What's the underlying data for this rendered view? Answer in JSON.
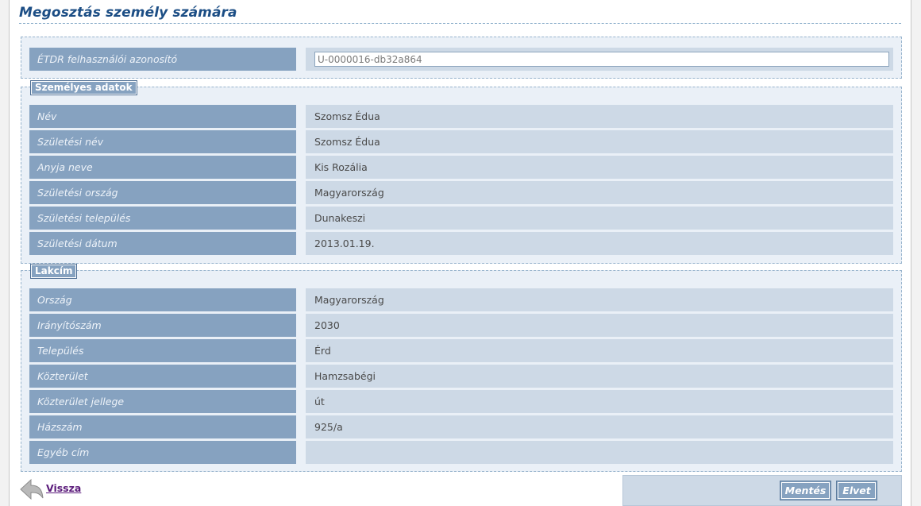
{
  "page_title": "Megosztás személy számára",
  "identifier": {
    "label": "ÉTDR felhasználói azonosító",
    "value": "U-0000016-db32a864"
  },
  "personal": {
    "legend": "Személyes adatok",
    "rows": [
      {
        "label": "Név",
        "value": "Szomsz Édua"
      },
      {
        "label": "Születési név",
        "value": "Szomsz Édua"
      },
      {
        "label": "Anyja neve",
        "value": "Kis Rozália"
      },
      {
        "label": "Születési ország",
        "value": "Magyarország"
      },
      {
        "label": "Születési település",
        "value": "Dunakeszi"
      },
      {
        "label": "Születési dátum",
        "value": "2013.01.19."
      }
    ]
  },
  "address": {
    "legend": "Lakcím",
    "rows": [
      {
        "label": "Ország",
        "value": "Magyarország"
      },
      {
        "label": "Irányítószám",
        "value": "2030"
      },
      {
        "label": "Település",
        "value": "Érd"
      },
      {
        "label": "Közterület",
        "value": "Hamzsabégi"
      },
      {
        "label": "Közterület jellege",
        "value": "út"
      },
      {
        "label": "Házszám",
        "value": "925/a"
      },
      {
        "label": "Egyéb cím",
        "value": ""
      }
    ]
  },
  "footer": {
    "back_label": "Vissza",
    "save_label": "Mentés",
    "reject_label": "Elvet"
  },
  "colors": {
    "title": "#1c4e85",
    "label_bg": "#86a2c0",
    "value_bg": "#cdd9e6",
    "section_bg": "#eaf0f7"
  }
}
